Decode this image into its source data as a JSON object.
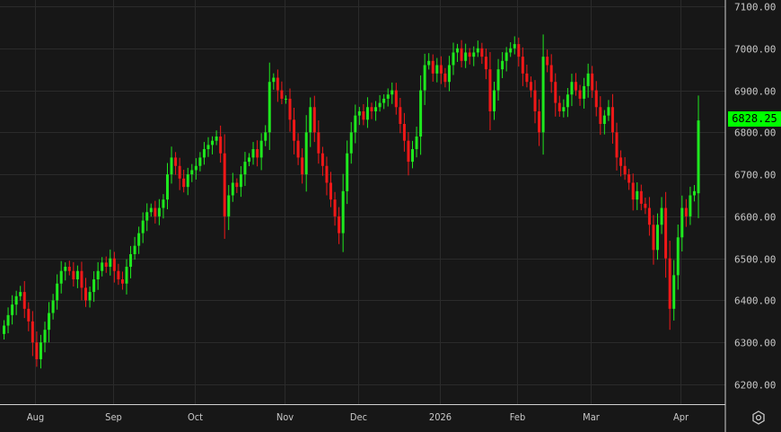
{
  "chart_data": {
    "type": "candlestick",
    "title": "",
    "ylim": [
      6150,
      7120
    ],
    "y_ticks": [
      "7100.00",
      "7000.00",
      "6900.00",
      "6800.00",
      "6700.00",
      "6600.00",
      "6500.00",
      "6400.00",
      "6300.00",
      "6200.00"
    ],
    "x_ticks": [
      {
        "label": "Aug",
        "index": 8
      },
      {
        "label": "Sep",
        "index": 27
      },
      {
        "label": "Oct",
        "index": 47
      },
      {
        "label": "Nov",
        "index": 69
      },
      {
        "label": "Dec",
        "index": 87
      },
      {
        "label": "2026",
        "index": 107
      },
      {
        "label": "Feb",
        "index": 126
      },
      {
        "label": "Mar",
        "index": 144
      },
      {
        "label": "Apr",
        "index": 166
      }
    ],
    "first_open": 6320,
    "close": [
      6340,
      6365,
      6390,
      6410,
      6420,
      6380,
      6350,
      6300,
      6260,
      6300,
      6330,
      6370,
      6400,
      6440,
      6470,
      6480,
      6470,
      6450,
      6470,
      6430,
      6400,
      6420,
      6450,
      6470,
      6490,
      6480,
      6500,
      6470,
      6450,
      6440,
      6480,
      6510,
      6530,
      6560,
      6590,
      6610,
      6620,
      6600,
      6620,
      6640,
      6700,
      6740,
      6720,
      6690,
      6670,
      6700,
      6710,
      6720,
      6740,
      6760,
      6770,
      6780,
      6790,
      6750,
      6600,
      6650,
      6680,
      6670,
      6700,
      6730,
      6740,
      6760,
      6740,
      6780,
      6800,
      6920,
      6930,
      6900,
      6880,
      6880,
      6830,
      6780,
      6740,
      6700,
      6800,
      6860,
      6800,
      6750,
      6720,
      6680,
      6640,
      6600,
      6560,
      6660,
      6750,
      6800,
      6840,
      6850,
      6830,
      6860,
      6850,
      6860,
      6870,
      6880,
      6890,
      6900,
      6860,
      6820,
      6780,
      6730,
      6760,
      6790,
      6900,
      6960,
      6970,
      6940,
      6960,
      6940,
      6920,
      6960,
      6990,
      7000,
      6970,
      6990,
      6980,
      6990,
      7000,
      6980,
      6950,
      6850,
      6900,
      6950,
      6970,
      6990,
      7000,
      7010,
      6980,
      6940,
      6920,
      6900,
      6850,
      6800,
      6980,
      6960,
      6920,
      6870,
      6850,
      6860,
      6890,
      6920,
      6900,
      6880,
      6910,
      6940,
      6900,
      6860,
      6820,
      6840,
      6860,
      6800,
      6740,
      6720,
      6700,
      6680,
      6640,
      6660,
      6630,
      6620,
      6580,
      6520,
      6580,
      6620,
      6500,
      6380,
      6460,
      6550,
      6620,
      6600,
      6650,
      6660,
      6828.25
    ],
    "last_price": "6828.25",
    "up_color": "#1ee81e",
    "down_color": "#f01818"
  },
  "settings_icon": "gear-icon"
}
